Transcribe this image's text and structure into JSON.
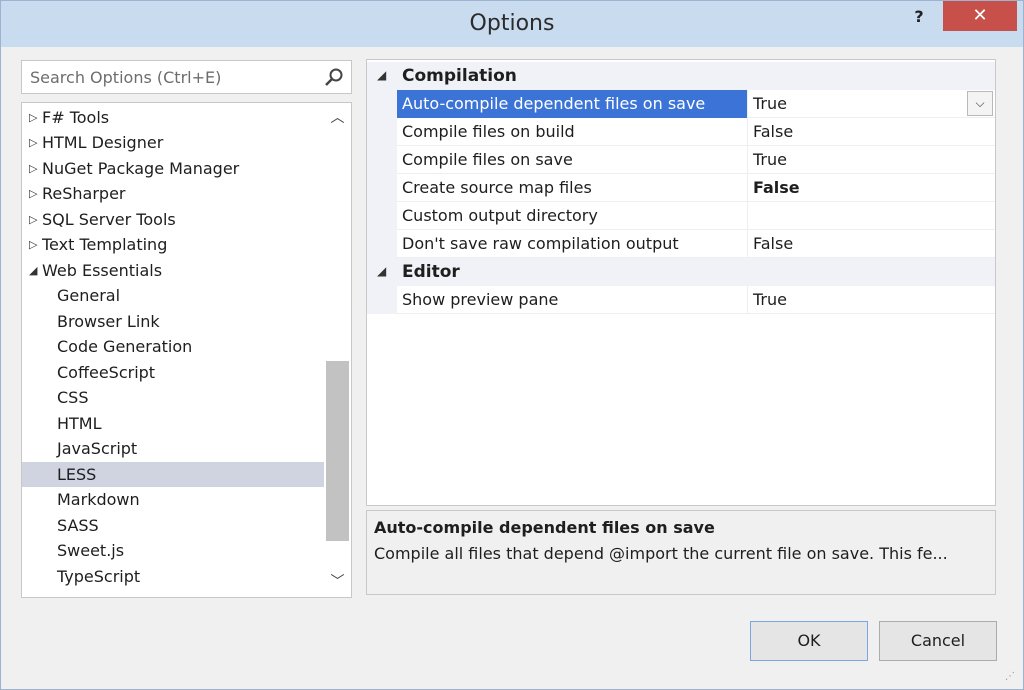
{
  "window": {
    "title": "Options",
    "help_label": "?",
    "close_label": "✕"
  },
  "search": {
    "placeholder": "Search Options (Ctrl+E)"
  },
  "tree": {
    "items": [
      {
        "label": "F# Tools",
        "expanded": false
      },
      {
        "label": "HTML Designer",
        "expanded": false
      },
      {
        "label": "NuGet Package Manager",
        "expanded": false
      },
      {
        "label": "ReSharper",
        "expanded": false
      },
      {
        "label": "SQL Server Tools",
        "expanded": false
      },
      {
        "label": "Text Templating",
        "expanded": false
      },
      {
        "label": "Web Essentials",
        "expanded": true
      }
    ],
    "children": [
      "General",
      "Browser Link",
      "Code Generation",
      "CoffeeScript",
      "CSS",
      "HTML",
      "JavaScript",
      "LESS",
      "Markdown",
      "SASS",
      "Sweet.js",
      "TypeScript"
    ],
    "selected": "LESS"
  },
  "grid": {
    "categories": [
      {
        "label": "Compilation",
        "properties": [
          {
            "name": "Auto-compile dependent files on save",
            "value": "True"
          },
          {
            "name": "Compile files on build",
            "value": "False"
          },
          {
            "name": "Compile files on save",
            "value": "True"
          },
          {
            "name": "Create source map files",
            "value": "False"
          },
          {
            "name": "Custom output directory",
            "value": ""
          },
          {
            "name": "Don't save raw compilation output",
            "value": "False"
          }
        ]
      },
      {
        "label": "Editor",
        "properties": [
          {
            "name": "Show preview pane",
            "value": "True"
          }
        ]
      }
    ]
  },
  "description": {
    "title": "Auto-compile dependent files on save",
    "text": "Compile all files that depend @import the current file on save.  This fe..."
  },
  "buttons": {
    "ok": "OK",
    "cancel": "Cancel"
  },
  "colors": {
    "selection": "#3b73d7",
    "tree_selection": "#d0d4e0",
    "close": "#c7504a",
    "titlebar": "#c9dbef"
  }
}
